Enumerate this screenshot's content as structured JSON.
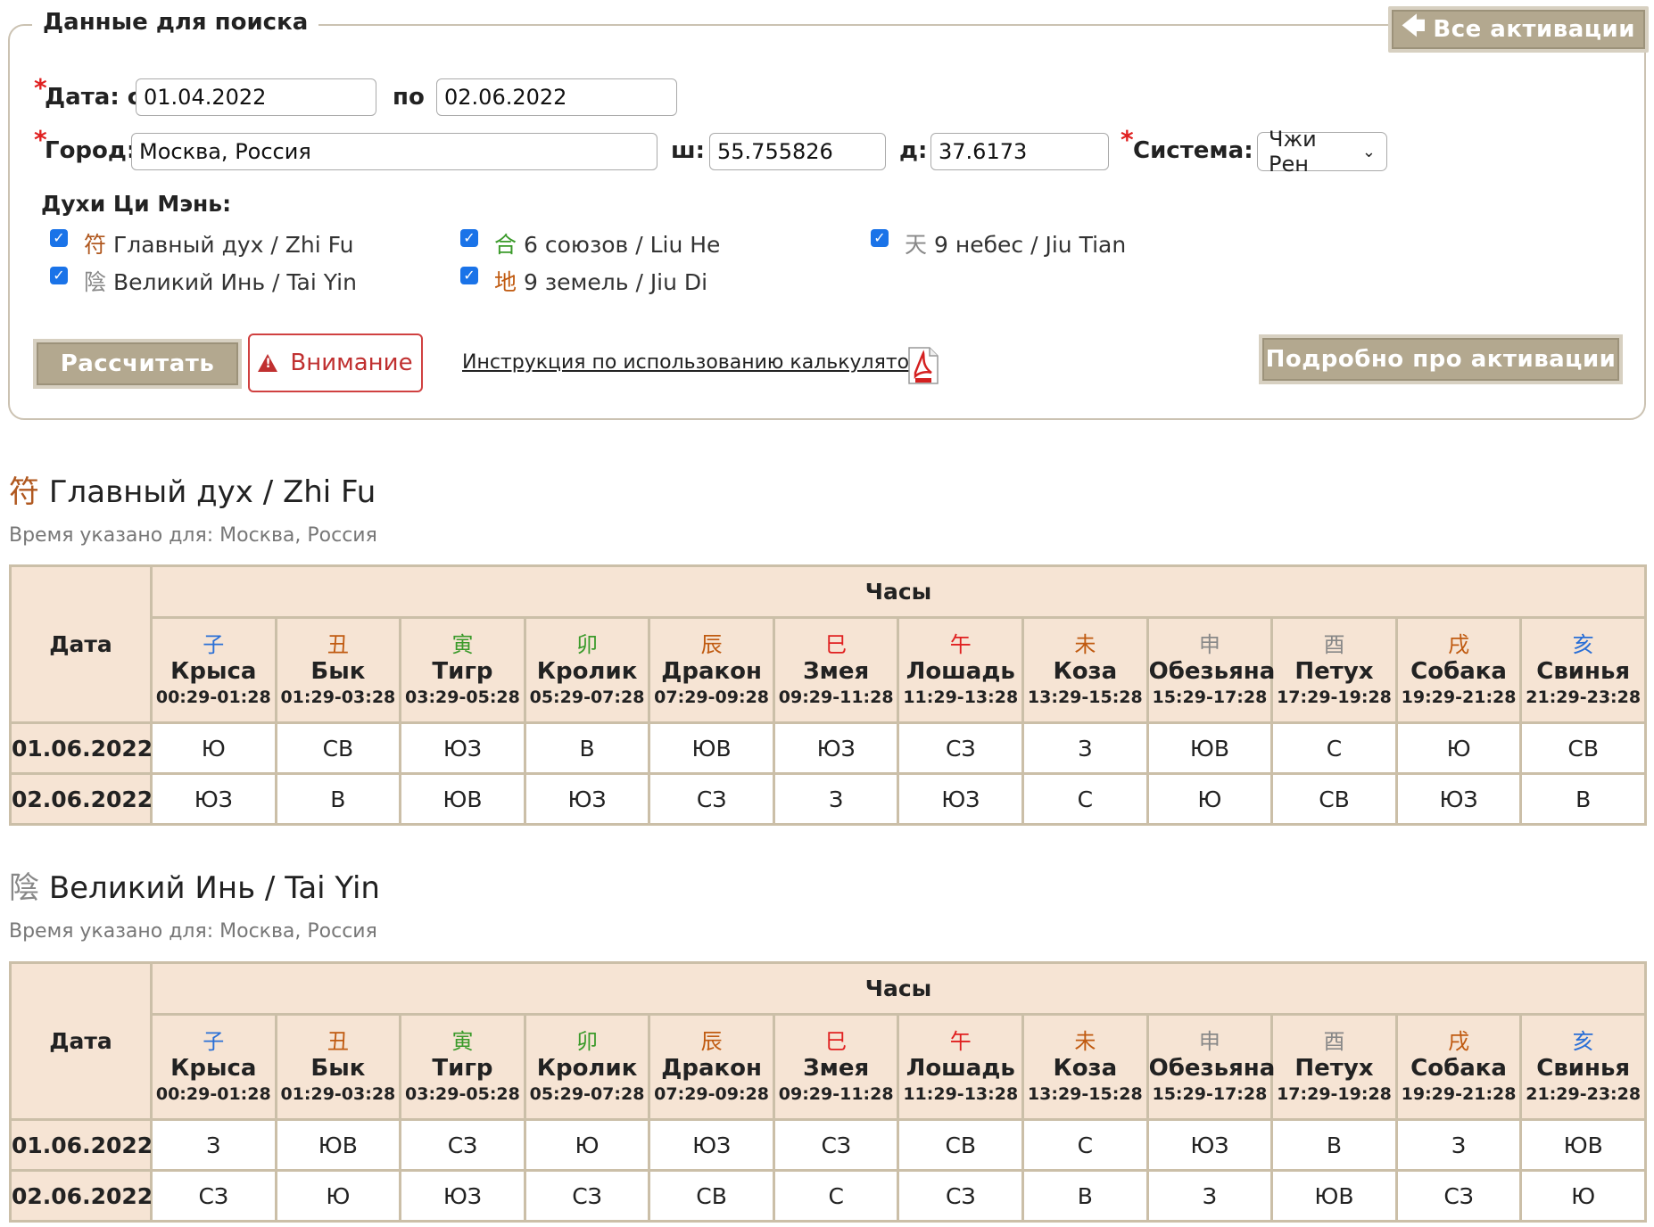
{
  "search": {
    "legend": "Данные для поиска",
    "all_activations": "Все активации",
    "date_from_label": "Дата: с",
    "date_from": "01.04.2022",
    "date_to_label": "по",
    "date_to": "02.06.2022",
    "city_label": "Город:",
    "city": "Москва, Россия",
    "lat_label": "ш:",
    "lat": "55.755826",
    "lon_label": "д:",
    "lon": "37.6173",
    "system_label": "Система:",
    "system": "Чжи Рен",
    "spirits_label": "Духи Ци Мэнь:",
    "spirits": [
      {
        "glyph": "符",
        "label": "Главный дух / Zhi Fu",
        "color": "#b0581f",
        "checked": true
      },
      {
        "glyph": "合",
        "label": "6 союзов / Liu He",
        "color": "#3a9a2a",
        "checked": true
      },
      {
        "glyph": "天",
        "label": "9 небес / Jiu Tian",
        "color": "#888888",
        "checked": true
      },
      {
        "glyph": "陰",
        "label": "Великий Инь / Tai Yin",
        "color": "#888888",
        "checked": true
      },
      {
        "glyph": "地",
        "label": "9 земель / Jiu Di",
        "color": "#c05a10",
        "checked": true
      }
    ],
    "calc_button": "Рассчитать",
    "warning_button": "Внимание",
    "instruction_link": "Инструкция по использованию калькулятора",
    "details_button": "Подробно про активации"
  },
  "colors": {
    "accent": "#b3a88f",
    "header_bg": "#f6e4d4",
    "border": "#cbbfa8"
  },
  "hours_header": "Часы",
  "date_header": "Дата",
  "hours": [
    {
      "glyph": "子",
      "color": "#2a6fd6",
      "name": "Крыса",
      "time": "00:29-01:28"
    },
    {
      "glyph": "丑",
      "color": "#c05a10",
      "name": "Бык",
      "time": "01:29-03:28"
    },
    {
      "glyph": "寅",
      "color": "#3a9a2a",
      "name": "Тигр",
      "time": "03:29-05:28"
    },
    {
      "glyph": "卯",
      "color": "#3a9a2a",
      "name": "Кролик",
      "time": "05:29-07:28"
    },
    {
      "glyph": "辰",
      "color": "#c05a10",
      "name": "Дракон",
      "time": "07:29-09:28"
    },
    {
      "glyph": "巳",
      "color": "#e02020",
      "name": "Змея",
      "time": "09:29-11:28"
    },
    {
      "glyph": "午",
      "color": "#e02020",
      "name": "Лошадь",
      "time": "11:29-13:28"
    },
    {
      "glyph": "未",
      "color": "#c05a10",
      "name": "Коза",
      "time": "13:29-15:28"
    },
    {
      "glyph": "申",
      "color": "#888888",
      "name": "Обезьяна",
      "time": "15:29-17:28"
    },
    {
      "glyph": "酉",
      "color": "#888888",
      "name": "Петух",
      "time": "17:29-19:28"
    },
    {
      "glyph": "戌",
      "color": "#c05a10",
      "name": "Собака",
      "time": "19:29-21:28"
    },
    {
      "glyph": "亥",
      "color": "#2a6fd6",
      "name": "Свинья",
      "time": "21:29-23:28"
    }
  ],
  "sections": [
    {
      "glyph": "符",
      "glyph_color": "#b0581f",
      "title": "Главный дух / Zhi Fu",
      "subtitle": "Время указано для: Москва, Россия",
      "rows": [
        {
          "date": "01.06.2022",
          "values": [
            "Ю",
            "СВ",
            "ЮЗ",
            "В",
            "ЮВ",
            "ЮЗ",
            "СЗ",
            "З",
            "ЮВ",
            "С",
            "Ю",
            "СВ"
          ]
        },
        {
          "date": "02.06.2022",
          "values": [
            "ЮЗ",
            "В",
            "ЮВ",
            "ЮЗ",
            "СЗ",
            "З",
            "ЮЗ",
            "С",
            "Ю",
            "СВ",
            "ЮЗ",
            "В"
          ]
        }
      ]
    },
    {
      "glyph": "陰",
      "glyph_color": "#888888",
      "title": "Великий Инь / Tai Yin",
      "subtitle": "Время указано для: Москва, Россия",
      "rows": [
        {
          "date": "01.06.2022",
          "values": [
            "З",
            "ЮВ",
            "СЗ",
            "Ю",
            "ЮЗ",
            "СЗ",
            "СВ",
            "С",
            "ЮЗ",
            "В",
            "З",
            "ЮВ"
          ]
        },
        {
          "date": "02.06.2022",
          "values": [
            "СЗ",
            "Ю",
            "ЮЗ",
            "СЗ",
            "СВ",
            "С",
            "СЗ",
            "В",
            "З",
            "ЮВ",
            "СЗ",
            "Ю"
          ]
        }
      ]
    }
  ]
}
